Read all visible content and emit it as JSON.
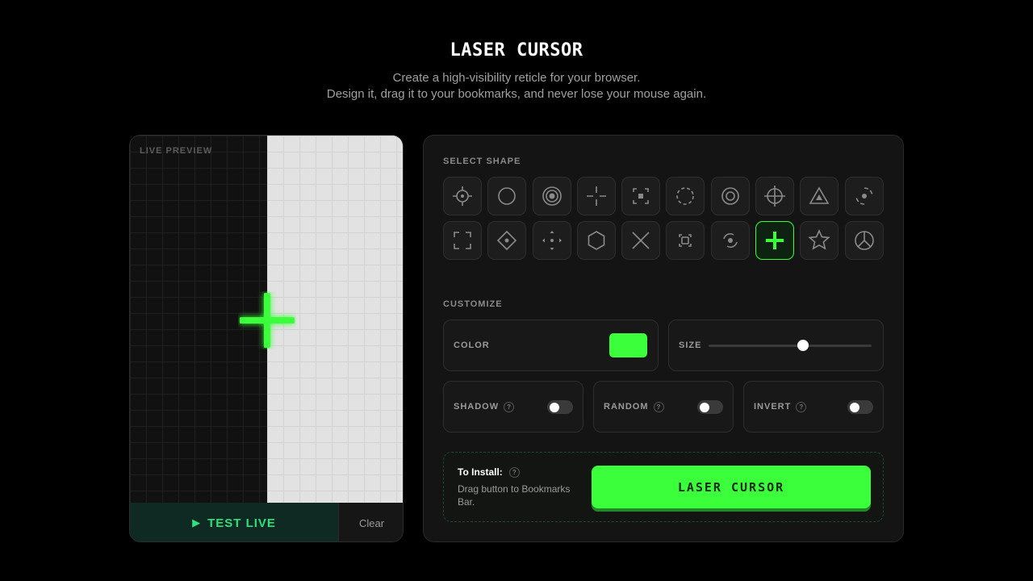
{
  "header": {
    "title": "LASER CURSOR",
    "subtitle_line1": "Create a high-visibility reticle for your browser.",
    "subtitle_line2": "Design it, drag it to your bookmarks, and never lose your mouse again."
  },
  "preview": {
    "label": "LIVE PREVIEW",
    "cursor_icon": "plus-icon",
    "test_live_label": "TEST LIVE",
    "clear_label": "Clear"
  },
  "shapes": {
    "label": "SELECT SHAPE",
    "selected": "plus",
    "items": [
      "dot-crosshair",
      "circle",
      "concentric-circles",
      "gap-crosshair",
      "bracket-dot",
      "dashed-circle",
      "ring-dot",
      "crosshair-circle",
      "triangle-dot",
      "partial-ring-dot",
      "corner-brackets",
      "diamond-dot",
      "arrows-cross",
      "hexagon",
      "x-cross",
      "square-brackets",
      "arc-dot",
      "plus",
      "star",
      "peace-circle"
    ]
  },
  "customize": {
    "label": "CUSTOMIZE",
    "color_label": "COLOR",
    "color_value": "#3cff3c",
    "size_label": "SIZE",
    "size_value": 0.58,
    "shadow_label": "SHADOW",
    "shadow_on": false,
    "random_label": "RANDOM",
    "random_on": false,
    "invert_label": "INVERT",
    "invert_on": false,
    "help_glyph": "?"
  },
  "install": {
    "title": "To Install:",
    "description": "Drag button to Bookmarks Bar.",
    "button_label": "LASER CURSOR"
  },
  "colors": {
    "accent": "#3cff3c",
    "accent_shadow": "#1f8a25",
    "test_live_text": "#2fe07a",
    "icon_inactive": "#8a8a8a"
  }
}
